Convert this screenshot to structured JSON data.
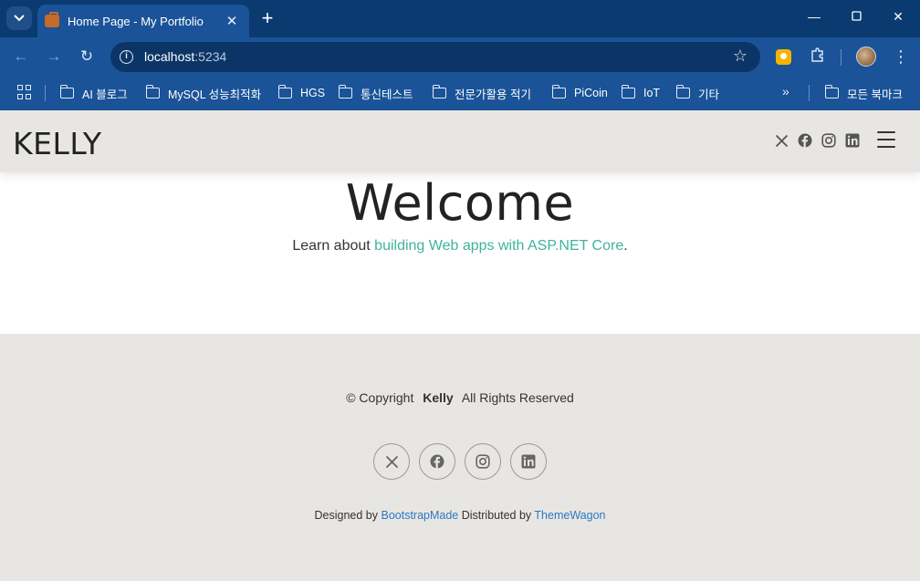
{
  "browser": {
    "tab_title": "Home Page - My Portfolio",
    "url_host": "localhost",
    "url_port": ":5234",
    "bookmarks": [
      "AI 블로그",
      "MySQL 성능최적화",
      "HGS",
      "통신테스트",
      "전문가활용 적기",
      "PiCoin",
      "IoT",
      "기타"
    ],
    "all_bookmarks": "모든 북마크",
    "icons": {
      "tab_list": "chevron-down-icon",
      "close": "close-icon",
      "new_tab": "plus-icon",
      "back": "arrow-left-icon",
      "forward": "arrow-right-icon",
      "reload": "reload-icon",
      "site_info": "info-icon",
      "bookmark_star": "star-icon",
      "extensions": "puzzle-icon",
      "menu": "kebab-icon",
      "apps": "apps-grid-icon",
      "folder": "folder-icon",
      "more": "double-chevron-icon"
    }
  },
  "site": {
    "brand": "KELLY",
    "welcome": "Welcome",
    "learn_prefix": "Learn about ",
    "learn_link": "building Web apps with ASP.NET Core",
    "learn_suffix": ".",
    "accent_color": "#3fb39b",
    "header_socials": [
      "x-icon",
      "facebook-icon",
      "instagram-icon",
      "linkedin-icon"
    ]
  },
  "footer": {
    "copyright_prefix": "© Copyright",
    "copyright_name": "Kelly",
    "copyright_suffix": "All Rights Reserved",
    "socials": [
      "x-icon",
      "facebook-icon",
      "instagram-icon",
      "linkedin-icon"
    ],
    "designed_by_label": "Designed by ",
    "designed_by_link": "BootstrapMade",
    "distributed_by_label": " Distributed by ",
    "distributed_by_link": "ThemeWagon"
  }
}
